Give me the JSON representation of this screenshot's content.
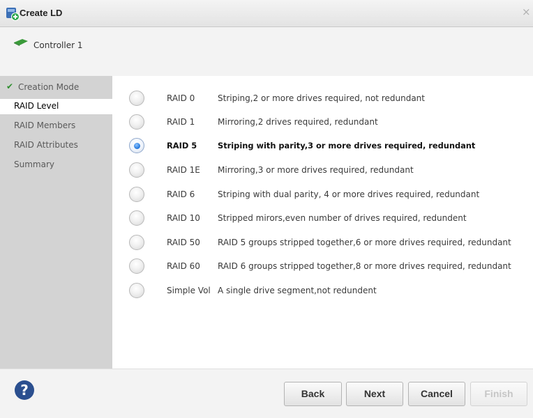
{
  "window": {
    "title": "Create LD",
    "close_glyph": "×"
  },
  "header": {
    "controller_label": "Controller 1",
    "controller_icon": "controller-card-icon"
  },
  "sidebar": {
    "items": [
      {
        "label": "Creation Mode",
        "state": "done"
      },
      {
        "label": "RAID Level",
        "state": "active"
      },
      {
        "label": "RAID Members",
        "state": "pending"
      },
      {
        "label": "RAID Attributes",
        "state": "pending"
      },
      {
        "label": "Summary",
        "state": "pending"
      }
    ],
    "check_glyph": "✔"
  },
  "raid_options": {
    "selected": "RAID 5",
    "items": [
      {
        "name": "RAID 0",
        "description": "Striping,2 or more drives required, not redundant"
      },
      {
        "name": "RAID 1",
        "description": "Mirroring,2 drives required, redundant"
      },
      {
        "name": "RAID 5",
        "description": "Striping with parity,3 or more drives required, redundant"
      },
      {
        "name": "RAID 1E",
        "description": "Mirroring,3 or more drives required, redundant"
      },
      {
        "name": "RAID 6",
        "description": "Striping with dual parity, 4 or more drives required, redundant"
      },
      {
        "name": "RAID 10",
        "description": "Stripped mirors,even number of drives required, redundent"
      },
      {
        "name": "RAID 50",
        "description": "RAID 5 groups stripped together,6 or more drives required, redundant"
      },
      {
        "name": "RAID 60",
        "description": "RAID 6 groups stripped together,8 or more drives required, redundant"
      },
      {
        "name": "Simple Vol",
        "description": "A single drive segment,not redundent"
      }
    ]
  },
  "footer": {
    "help_glyph": "?",
    "back_label": "Back",
    "next_label": "Next",
    "cancel_label": "Cancel",
    "finish_label": "Finish",
    "finish_enabled": false
  },
  "colors": {
    "accent": "#2d7fe0",
    "sidebar_bg": "#d3d3d3",
    "check": "#2f8f2f"
  }
}
